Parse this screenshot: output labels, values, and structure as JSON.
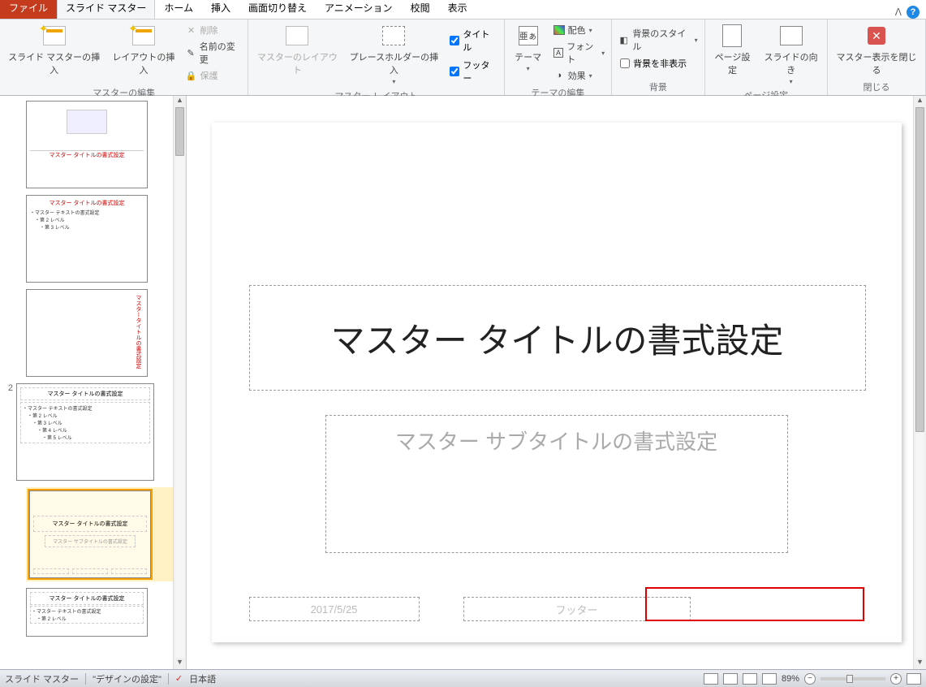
{
  "tabs": {
    "file": "ファイル",
    "slidemaster": "スライド マスター",
    "home": "ホーム",
    "insert": "挿入",
    "transition": "画面切り替え",
    "animation": "アニメーション",
    "review": "校閲",
    "view": "表示"
  },
  "ribbon": {
    "edit_master": {
      "insert_slide_master": "スライド マスターの挿入",
      "insert_layout": "レイアウトの挿入",
      "delete": "削除",
      "rename": "名前の変更",
      "preserve": "保護",
      "group_label": "マスターの編集"
    },
    "master_layout": {
      "master_layout": "マスターのレイアウト",
      "insert_placeholder": "プレースホルダーの挿入",
      "title_cb": "タイトル",
      "footer_cb": "フッター",
      "group_label": "マスター レイアウト"
    },
    "theme_edit": {
      "theme": "テーマ",
      "colors": "配色",
      "fonts": "フォント",
      "effects": "効果",
      "group_label": "テーマの編集"
    },
    "background": {
      "bg_style": "背景のスタイル",
      "hide_bg": "背景を非表示",
      "group_label": "背景"
    },
    "page_setup": {
      "page_setup": "ページ設定",
      "slide_orientation": "スライドの向き",
      "group_label": "ページ設定"
    },
    "close": {
      "close_master": "マスター表示を閉じる",
      "group_label": "閉じる"
    }
  },
  "thumbs": {
    "master1": {
      "title": "マスター タイトルの書式設定"
    },
    "layout1": {
      "title": "マスター タイトルの書式設定",
      "body": "・マスター テキストの書式設定\n　・第 2 レベル\n　　・第 3 レベル"
    },
    "layout2": {
      "title": "マスタータイトルの書式設定"
    },
    "master2_num": "2",
    "master2": {
      "title": "マスター タイトルの書式設定",
      "body": "・マスター テキストの書式設定\n　・第 2 レベル\n　　・第 3 レベル\n　　　・第 4 レベル\n　　　　・第 5 レベル"
    },
    "layout3_selected": {
      "title": "マスター タイトルの書式設定",
      "subtitle": "マスター サブタイトルの書式設定"
    },
    "layout4": {
      "title": "マスター タイトルの書式設定",
      "body": "・マスター テキストの書式設定\n　・第 2 レベル"
    }
  },
  "slide": {
    "title": "マスター タイトルの書式設定",
    "subtitle": "マスター サブタイトルの書式設定",
    "date": "2017/5/25",
    "footer": "フッター"
  },
  "status": {
    "mode": "スライド マスター",
    "theme": "\"デザインの設定\"",
    "lang": "日本語",
    "zoom": "89%"
  }
}
